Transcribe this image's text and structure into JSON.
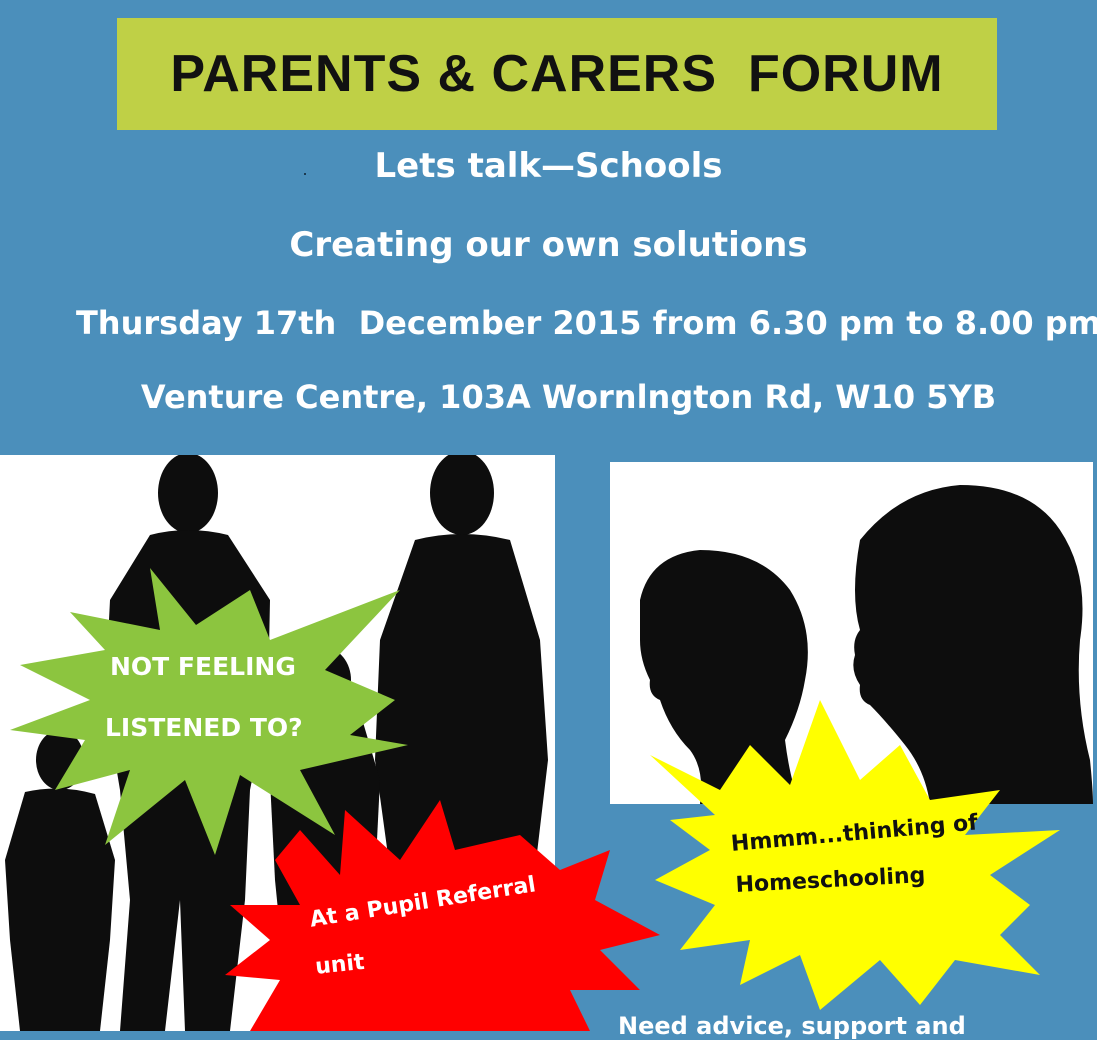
{
  "colors": {
    "background": "#4b8fbb",
    "banner": "#bfd046",
    "silhouette": "#0d0d0d",
    "burst_green": "#8cc53f",
    "burst_red": "#ff0000",
    "burst_yellow": "#ffff00"
  },
  "banner": {
    "title": "PARENTS & CARERS  FORUM"
  },
  "event": {
    "line1": "Lets talk—Schools",
    "line2": "Creating our own solutions",
    "line3": "Thursday 17th  December 2015 from 6.30 pm to 8.00 pm",
    "line4": "Venture Centre, 103A Wornlngton Rd, W10 5YB"
  },
  "bursts": {
    "green": {
      "line1": "NOT FEELING",
      "line2": "LISTENED TO?"
    },
    "red": {
      "line1": "At a Pupil Referral",
      "line2": "unit"
    },
    "yellow": {
      "line1": "Hmmm...thinking of",
      "line2": "Homeschooling"
    }
  },
  "bottom_text": "Need advice, support and"
}
